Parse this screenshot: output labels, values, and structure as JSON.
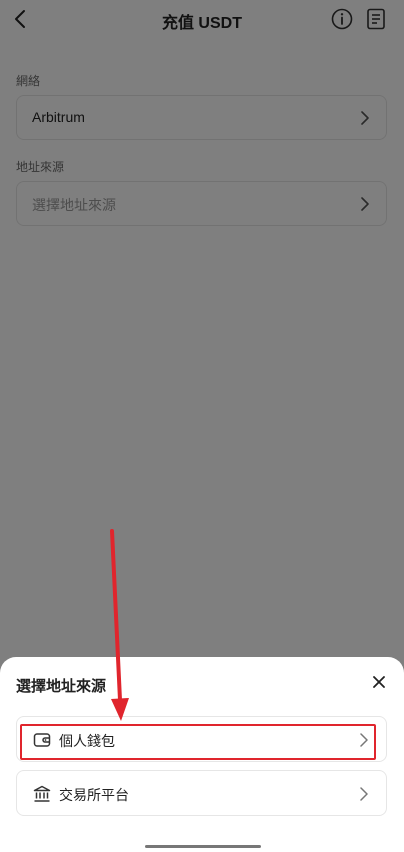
{
  "header": {
    "title": "充值 USDT"
  },
  "form": {
    "network_label": "網絡",
    "network_value": "Arbitrum",
    "source_label": "地址來源",
    "source_placeholder": "選擇地址來源"
  },
  "sheet": {
    "title": "選擇地址來源",
    "options": [
      {
        "label": "個人錢包",
        "icon": "wallet-icon"
      },
      {
        "label": "交易所平台",
        "icon": "bank-icon"
      }
    ]
  },
  "colors": {
    "annotation": "#e0252d",
    "overlay": "rgba(0,0,0,0.5)"
  }
}
